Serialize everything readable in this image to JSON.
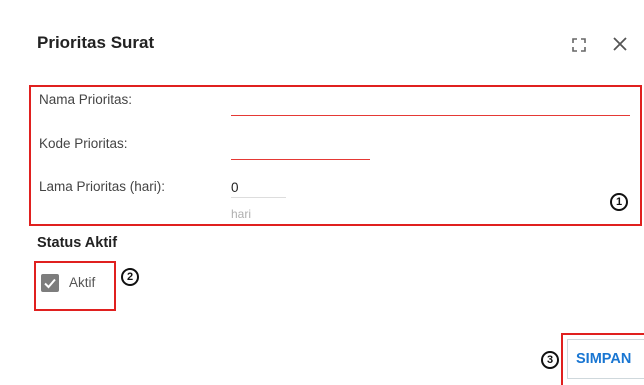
{
  "dialog": {
    "title": "Prioritas Surat"
  },
  "form": {
    "nama": {
      "label": "Nama Prioritas:",
      "value": ""
    },
    "kode": {
      "label": "Kode Prioritas:",
      "value": ""
    },
    "lama": {
      "label": "Lama Prioritas (hari):",
      "value": "0",
      "unit": "hari"
    }
  },
  "status": {
    "section_title": "Status Aktif",
    "checkbox_label": "Aktif",
    "checked": true
  },
  "actions": {
    "save_label": "SIMPAN"
  },
  "markers": [
    "1",
    "2",
    "3"
  ],
  "colors": {
    "highlight": "#e0201f",
    "error_underline": "#e53935",
    "primary": "#1976d2",
    "checkbox": "#7d7d7d"
  }
}
